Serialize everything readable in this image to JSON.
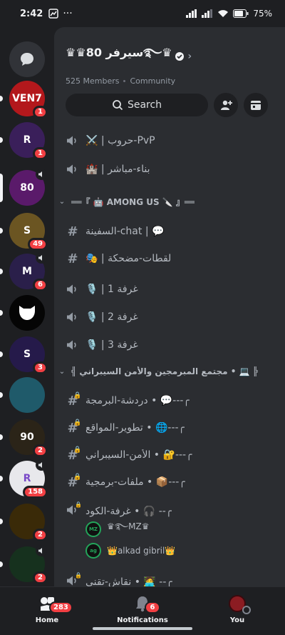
{
  "status_bar": {
    "time": "2:42",
    "battery": "75%"
  },
  "server_rail": [
    {
      "name": "dm",
      "label": "",
      "badge": "",
      "bg": "#313338",
      "icon": "chat-bubble-icon"
    },
    {
      "name": "ven7",
      "label": "VEN7",
      "badge": "1",
      "bg": "#b3181c"
    },
    {
      "name": "r-server",
      "label": "R",
      "badge": "1",
      "bg": "#3a1f5a"
    },
    {
      "name": "server-80",
      "label": "80",
      "badge": "",
      "bg": "#5a1a6a",
      "active": true,
      "voice": true
    },
    {
      "name": "s-server",
      "label": "S",
      "badge": "49",
      "bg": "#6b5522"
    },
    {
      "name": "m-server",
      "label": "M",
      "badge": "6",
      "bg": "#2a1f4a",
      "voice": true
    },
    {
      "name": "cat-server",
      "label": "",
      "badge": "",
      "bg": "#050505"
    },
    {
      "name": "purple-server",
      "label": "S",
      "badge": "3",
      "bg": "#251a4a"
    },
    {
      "name": "avatar-server",
      "label": "",
      "badge": "",
      "bg": "#1f5a6a"
    },
    {
      "name": "server-90",
      "label": "90",
      "badge": "2",
      "bg": "#2b2418"
    },
    {
      "name": "r2-server",
      "label": "R",
      "badge": "158",
      "bg": "#e8e8ec",
      "voice": true
    },
    {
      "name": "trophy-server",
      "label": "",
      "badge": "2",
      "bg": "#3a2a08"
    },
    {
      "name": "saudi-server",
      "label": "",
      "badge": "2",
      "bg": "#16311e",
      "voice": true
    }
  ],
  "server": {
    "name": "♛♛سيرفر 80࿐♛",
    "members": "525 Members",
    "type": "Community",
    "search_label": "Search"
  },
  "channels": [
    {
      "type": "voice",
      "name": "⚔️ | حروب-PvP"
    },
    {
      "type": "voice",
      "name": "🏰 | بناء-مباشر"
    },
    {
      "type": "category",
      "name": "══『 🤖 AMONG US 🔪 』══"
    },
    {
      "type": "text",
      "name": "السفينة-chat | 💬"
    },
    {
      "type": "text",
      "name": "🎭 | لقطات-مضحكة"
    },
    {
      "type": "voice",
      "name": "🎙️ | 1 غرفة"
    },
    {
      "type": "voice",
      "name": "🎙️ | 2 غرفة"
    },
    {
      "type": "voice",
      "name": "🎙️ | 3 غرفة"
    },
    {
      "type": "category",
      "name": "╣ مجتمع المبرمجين والأمن السيبراني • 💻 ╠"
    },
    {
      "type": "text-locked",
      "name": "دردشة-البرمجة • 💬---╭"
    },
    {
      "type": "text-locked",
      "name": "تطوير-المواقع • 🌐---╭"
    },
    {
      "type": "text-locked",
      "name": "الأمن-السيبراني • 🔐---╭"
    },
    {
      "type": "text-locked",
      "name": "ملفات-برمجية • 📦---╭"
    },
    {
      "type": "voice-locked",
      "name": "غرفة-الكود • 🎧 --╭"
    },
    {
      "type": "user",
      "name": "♛࿐MZ♛",
      "avatar": "MZ"
    },
    {
      "type": "user",
      "name": "👑alkad gibril👑",
      "avatar": "ag"
    },
    {
      "type": "voice-locked",
      "name": "نقاش-تقني • 🧑‍💻 --╭"
    }
  ],
  "bottom_nav": {
    "home": {
      "label": "Home",
      "badge": "283"
    },
    "notifications": {
      "label": "Notifications",
      "badge": "6"
    },
    "you": {
      "label": "You"
    }
  }
}
